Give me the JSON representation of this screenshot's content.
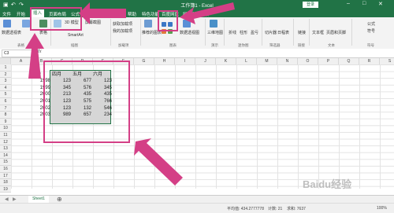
{
  "app": {
    "title": "工作簿1 - Excel",
    "login": "登录",
    "accent": "#217346",
    "highlight_color": "#d43f86"
  },
  "tabs": [
    "文件",
    "开始",
    "插入",
    "页面布局",
    "公式",
    "数据",
    "审阅",
    "视图",
    "帮助",
    "特色功能",
    "百度网盘",
    "操作说明搜索"
  ],
  "active_tab": "插入",
  "ribbon": {
    "groups": [
      "表格",
      "插图",
      "加载项",
      "图表",
      "迷你图",
      "筛选器",
      "链接",
      "文本",
      "符号"
    ],
    "labels": {
      "pivot": "数据透视表",
      "recommended_pivot": "推荐的数据透视表",
      "table": "表格",
      "pictures": "图片",
      "shapes": "形状",
      "icons": "图标",
      "model3d": "3D 模型",
      "smartart": "SmartArt",
      "screenshot": "屏幕截图",
      "get_addins": "获取加载项",
      "my_addins": "我的加载项",
      "rec_charts": "推荐的图表",
      "pivot_chart": "数据透视图",
      "map3d": "三维地图",
      "line": "折线",
      "column": "柱形",
      "winloss": "盈亏",
      "slicer": "切片器",
      "timeline": "日程表",
      "link": "链接",
      "textbox": "文本框",
      "header_footer": "页眉和页脚",
      "equation": "公式",
      "symbol": "符号",
      "tour": "演示"
    }
  },
  "formula_bar": {
    "namebox": "C3",
    "fx": "fx",
    "value": ""
  },
  "columns": [
    "A",
    "B",
    "C",
    "D",
    "E",
    "F",
    "G",
    "H",
    "I",
    "J",
    "K",
    "L",
    "M",
    "N",
    "O",
    "P",
    "Q",
    "R",
    "S"
  ],
  "rows": [
    "1",
    "2",
    "3",
    "4",
    "5",
    "6",
    "7",
    "8",
    "9",
    "10",
    "11",
    "12",
    "13",
    "14",
    "15",
    "16",
    "17",
    "18",
    "19"
  ],
  "sheet": {
    "year_header": "年份",
    "month_headers": [
      "四月",
      "五月",
      "六月"
    ],
    "years": [
      "1998",
      "1999",
      "2000",
      "2001",
      "2002",
      "2003"
    ],
    "data": [
      [
        "123",
        "677",
        "123"
      ],
      [
        "345",
        "576",
        "345"
      ],
      [
        "213",
        "435",
        "435"
      ],
      [
        "123",
        "575",
        "766"
      ],
      [
        "123",
        "132",
        "546"
      ],
      [
        "989",
        "657",
        "234"
      ]
    ]
  },
  "sheet_tabs": [
    "Sheet1"
  ],
  "status": {
    "average": "平均值: 434.2777778",
    "count": "计数: 21",
    "sum": "求和: 7637",
    "zoom": "100%"
  },
  "watermark": "Baidu经验"
}
